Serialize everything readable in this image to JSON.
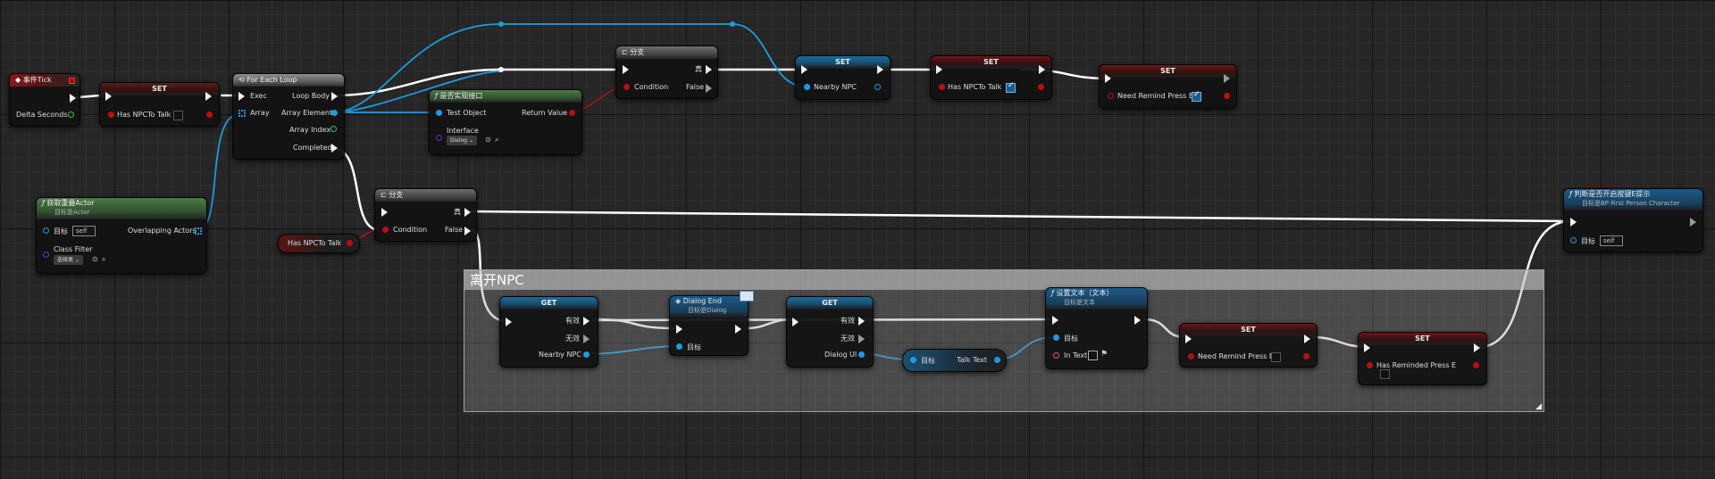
{
  "nodes": {
    "event_tick": {
      "title": "事件Tick",
      "delta": "Delta Seconds"
    },
    "set1": {
      "title": "SET",
      "var": "Has NPCTo Talk"
    },
    "foreach": {
      "title": "For Each Loop",
      "exec": "Exec",
      "array": "Array",
      "loop_body": "Loop Body",
      "array_element": "Array Element",
      "array_index": "Array Index",
      "completed": "Completed"
    },
    "get_overlap": {
      "title": "获取重叠Actor",
      "subtitle": "目标是Actor",
      "target": "目标",
      "self": "self",
      "overlapping": "Overlapping Actors",
      "class_filter": "Class Filter",
      "select_class": "选择类"
    },
    "impl_iface": {
      "title": "是否实现接口",
      "test_object": "Test Object",
      "return_value": "Return Value",
      "interface": "Interface",
      "dialog": "Dialog"
    },
    "branch1": {
      "title": "分支",
      "true": "真",
      "condition": "Condition",
      "false": "False"
    },
    "set_nearby": {
      "title": "SET",
      "var": "Nearby NPC"
    },
    "set_has_npc": {
      "title": "SET",
      "var": "Has NPCTo Talk"
    },
    "set_need_remind": {
      "title": "SET",
      "var": "Need Remind Press E"
    },
    "branch2": {
      "title": "分支",
      "true": "真",
      "condition": "Condition",
      "false": "False"
    },
    "has_npc_getter": {
      "label": "Has NPCTo Talk"
    },
    "judge": {
      "title": "判断是否开启按键E提示",
      "subtitle": "目标是BP First Person Character",
      "target": "目标",
      "self": "self"
    },
    "get1": {
      "title": "GET",
      "valid": "有效",
      "invalid": "无效",
      "var": "Nearby NPC"
    },
    "dialog_end": {
      "title": "Dialog End",
      "subtitle": "目标是Dialog",
      "target": "目标"
    },
    "get2": {
      "title": "GET",
      "valid": "有效",
      "invalid": "无效",
      "var": "Dialog UI"
    },
    "talk_text": {
      "target": "目标",
      "var": "Talk Text"
    },
    "set_text": {
      "title": "设置文本（文本）",
      "subtitle": "目标是文本",
      "target": "目标",
      "in_text": "In Text"
    },
    "set_need_remind2": {
      "title": "SET",
      "var": "Need Remind Press E"
    },
    "set_has_reminded": {
      "title": "SET",
      "var": "Has Reminded Press E"
    }
  },
  "comment": {
    "title": "离开NPC"
  },
  "colors": {
    "exec": "#f2f2f2",
    "object": "#1e9ae0",
    "bool": "#b80f0f",
    "float": "#3ec14e",
    "interface": "#6a2bd8"
  }
}
